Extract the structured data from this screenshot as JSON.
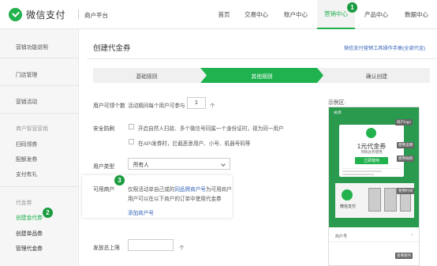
{
  "header": {
    "logo_text": "微信支付",
    "merchant_platform": "商户平台",
    "nav": [
      {
        "label": "首页"
      },
      {
        "label": "交易中心"
      },
      {
        "label": "账户中心"
      },
      {
        "label": "营销中心",
        "active": true
      },
      {
        "label": "产品中心"
      },
      {
        "label": "数据中心"
      }
    ]
  },
  "badges": {
    "one": "1",
    "two": "2",
    "three": "3"
  },
  "sidebar": {
    "items": [
      {
        "label": "营销功能说明"
      },
      {
        "label": "门店管理"
      },
      {
        "label": "营销活动"
      },
      {
        "label": "商户智营营销",
        "group": true
      },
      {
        "label": "扫码领券"
      },
      {
        "label": "配额发券"
      },
      {
        "label": "支付有礼"
      },
      {
        "label": "代金券",
        "group": true
      },
      {
        "label": "创建金代券",
        "active": true
      },
      {
        "label": "创建单品券"
      },
      {
        "label": "管理代金券"
      }
    ]
  },
  "main": {
    "title": "创建代金券",
    "help_link": "微信支付营销工具操作手册(全部代金)",
    "steps": [
      "基础规则",
      "其他规则",
      "确认创建"
    ],
    "form": {
      "per_user_label": "用户可领个数",
      "per_user_text": "活动期间每个用户可参与",
      "per_user_value": "1",
      "per_user_unit": "个",
      "security_label": "安全防刷",
      "security_opt1": "开启自然人扫款、多个微信号同属一个身份证时，视为同一用户",
      "security_opt2": "在API发券时，拦截恶意用户、小号、机器号码等",
      "user_type_label": "用户类型",
      "user_type_value": "所有人",
      "merchant_label": "可用商户",
      "merchant_text_prefix": "仅限活动单自己或的",
      "merchant_text_link": "同品牌商户号",
      "merchant_text_suffix": "为可用商户",
      "merchant_text_line2": "用户可以在以下商户的订单中使用代金券",
      "add_merchant_link": "添加商户号",
      "issue_limit_label": "发放总上限",
      "issue_limit_unit": "个"
    }
  },
  "preview": {
    "label": "示例区:",
    "topbar_text": "关闭",
    "merchant_page_tag": "商户logo",
    "coupon_amount": "1元代金券",
    "coupon_sub": "项目此券使用",
    "use_button": "立即使用",
    "tag_desc": "使用说明",
    "tag_rule": "使用规则",
    "tag_time": "使用时间",
    "brand_text": "微信支付",
    "merchant_row": "商户号",
    "tag_service": "查看服务"
  },
  "colors": {
    "brand_green": "#21b14d",
    "step_green": "#1fb24e",
    "link_blue": "#3565b8"
  }
}
